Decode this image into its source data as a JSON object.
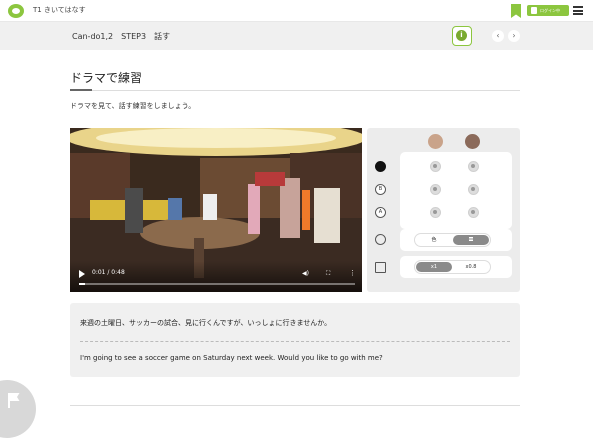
{
  "header": {
    "app_title": "T1 きいてはなす",
    "user_button_label": "ログイン中",
    "logo_icon": "logo-icon",
    "bookmark_icon": "bookmark-icon",
    "menu_icon": "hamburger-menu-icon"
  },
  "subbar": {
    "breadcrumb": "Can-do1,2　STEP3　話す",
    "info_label": "i",
    "prev_label": "‹",
    "next_label": "›"
  },
  "main": {
    "heading": "ドラマで練習",
    "instruction": "ドラマを見て、話す練習をしましょう。"
  },
  "video": {
    "current_time": "0:01 / 0:48",
    "progress": 0.02
  },
  "practice_panel": {
    "rows": [
      {
        "icon": "speaker-icon",
        "label": ""
      },
      {
        "icon": "b-icon",
        "label": "B"
      },
      {
        "icon": "a-icon",
        "label": "A"
      }
    ],
    "speed_label_hidden": "字幕",
    "subtitle_toggle": {
      "options": [
        "色",
        "〓"
      ],
      "selected": 1
    },
    "speed_toggle": {
      "options": [
        "x1",
        "x0.8"
      ],
      "selected": 0
    },
    "timer_icon": "timer-icon",
    "video_icon": "video-icon"
  },
  "script": {
    "japanese": "来週の土曜日、サッカーの試合、見に行くんですが、いっしょに行きませんか。",
    "english": "I'm going to see a soccer game on Saturday next week. Would you like to go with me?"
  },
  "colors": {
    "accent": "#8cc63f",
    "panel_bg": "#ececec",
    "script_bg": "#f0f0f0"
  }
}
